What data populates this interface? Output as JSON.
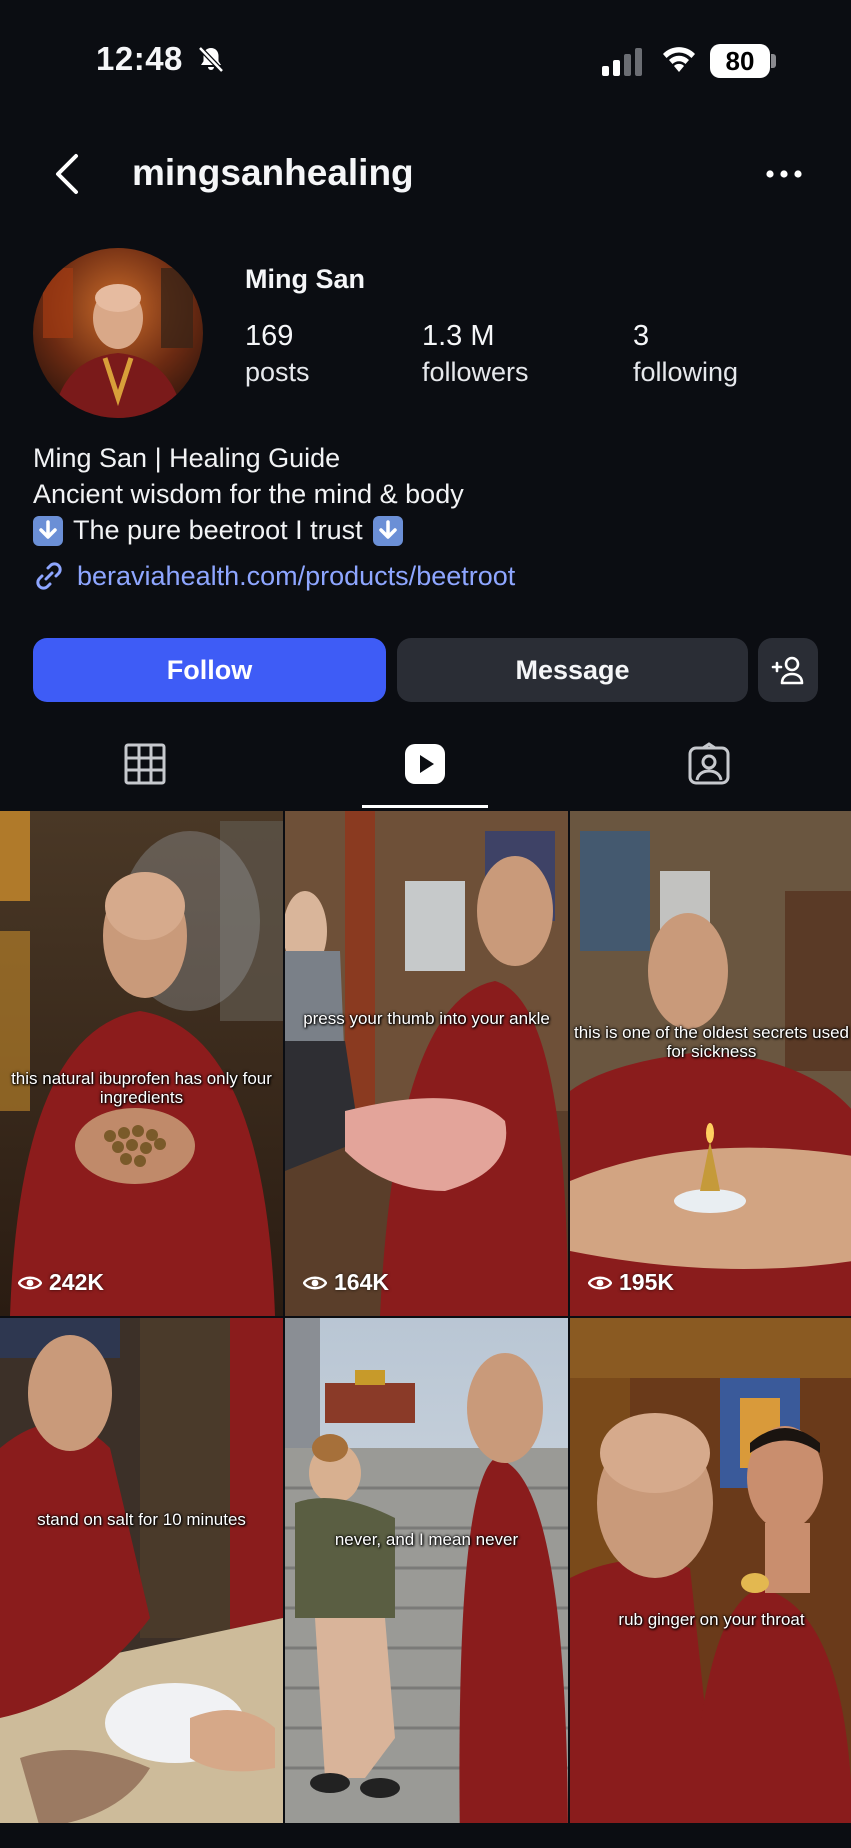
{
  "status_bar": {
    "time": "12:48",
    "battery": "80",
    "icons": [
      "bell-off-icon",
      "signal-icon",
      "wifi-icon",
      "battery-icon"
    ]
  },
  "header": {
    "username": "mingsanhealing",
    "back_icon": "chevron-left-icon",
    "more_icon": "more-horizontal-icon"
  },
  "profile": {
    "display_name": "Ming San",
    "stats": [
      {
        "value": "169",
        "label": "posts"
      },
      {
        "value": "1.3 M",
        "label": "followers"
      },
      {
        "value": "3",
        "label": "following"
      }
    ],
    "bio": [
      "Ming San | Healing Guide",
      "Ancient wisdom for the mind & body",
      "The pure beetroot I trust"
    ],
    "link": "beraviahealth.com/products/beetroot"
  },
  "actions": {
    "follow": "Follow",
    "message": "Message"
  },
  "tabs": [
    "grid-icon",
    "reels-icon",
    "tagged-icon"
  ],
  "active_tab": "reels",
  "accent_color": "#3e5cf6",
  "link_color": "#8ea6ff",
  "reels": [
    {
      "caption": "this natural ibuprofen has only four ingredients",
      "views": "242K"
    },
    {
      "caption": "press your thumb into your ankle",
      "views": "164K"
    },
    {
      "caption": "this is one of the oldest secrets used for sickness",
      "views": "195K"
    },
    {
      "caption": "stand on salt for 10 minutes",
      "views": ""
    },
    {
      "caption": "never, and I mean never",
      "views": ""
    },
    {
      "caption": "rub ginger on your throat",
      "views": ""
    }
  ]
}
